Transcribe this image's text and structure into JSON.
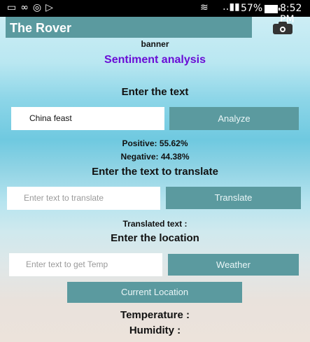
{
  "status_bar": {
    "battery": "57%",
    "time": "8:52 PM"
  },
  "app_bar": {
    "title": "The Rover",
    "camera_icon": "camera-icon"
  },
  "banner": "banner",
  "sentiment": {
    "heading": "Sentiment analysis",
    "prompt": "Enter the text",
    "input_value": "China feast",
    "analyze_label": "Analyze",
    "positive": "Positive: 55.62%",
    "negative": "Negative: 44.38%"
  },
  "translate": {
    "prompt": "Enter the text to translate",
    "placeholder": "Enter text to translate",
    "button_label": "Translate",
    "result_label": "Translated text :"
  },
  "location": {
    "prompt": "Enter the location",
    "placeholder": "Enter text to get Temp",
    "weather_label": "Weather",
    "current_location_label": "Current Location",
    "temperature_label": "Temperature :",
    "humidity_label": "Humidity :"
  }
}
